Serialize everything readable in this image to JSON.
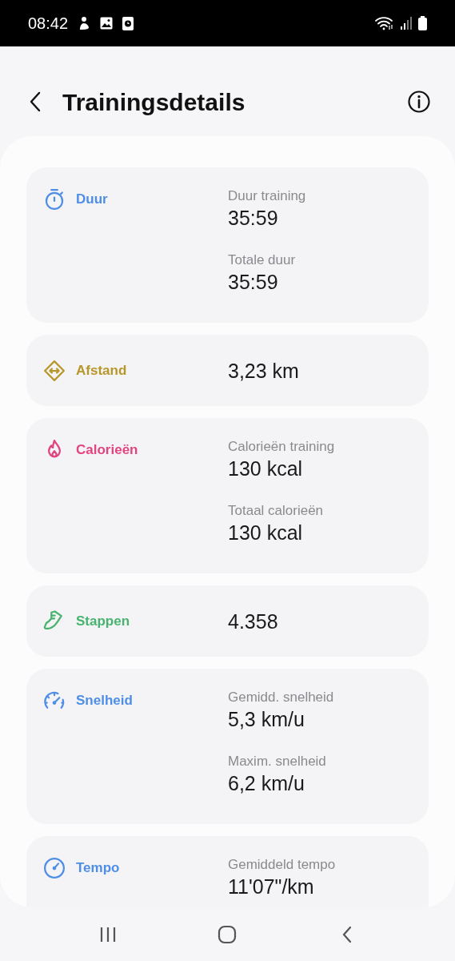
{
  "status_bar": {
    "time": "08:42"
  },
  "header": {
    "title": "Trainingsdetails"
  },
  "cards": [
    {
      "kind": "timer",
      "label": "Duur",
      "color": "#4f8ee6",
      "metrics": [
        {
          "label": "Duur training",
          "value": "35:59"
        },
        {
          "label": "Totale duur",
          "value": "35:59"
        }
      ]
    },
    {
      "kind": "distance",
      "label": "Afstand",
      "color": "#b8972a",
      "metrics": [
        {
          "value": "3,23 km"
        }
      ]
    },
    {
      "kind": "flame",
      "label": "Calorieën",
      "color": "#e0457f",
      "metrics": [
        {
          "label": "Calorieën training",
          "value": "130 kcal"
        },
        {
          "label": "Totaal calorieën",
          "value": "130 kcal"
        }
      ]
    },
    {
      "kind": "shoe",
      "label": "Stappen",
      "color": "#48b36f",
      "metrics": [
        {
          "value": "4.358"
        }
      ]
    },
    {
      "kind": "speed",
      "label": "Snelheid",
      "color": "#4f8ee6",
      "metrics": [
        {
          "label": "Gemidd. snelheid",
          "value": "5,3 km/u"
        },
        {
          "label": "Maxim. snelheid",
          "value": "6,2 km/u"
        }
      ]
    },
    {
      "kind": "tempo",
      "label": "Tempo",
      "color": "#4f8ee6",
      "metrics": [
        {
          "label": "Gemiddeld tempo",
          "value": "11'07\"/km"
        }
      ]
    }
  ]
}
